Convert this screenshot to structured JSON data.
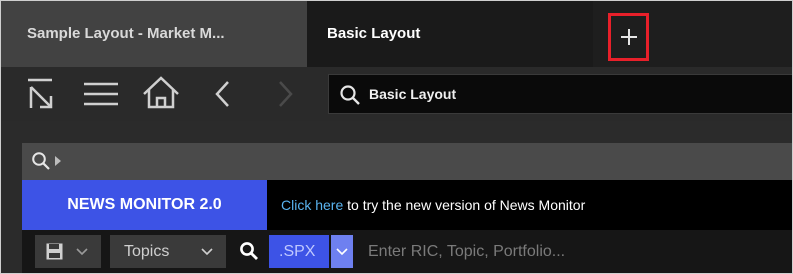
{
  "tabs": [
    {
      "label": "Sample Layout - Market M...",
      "active": false
    },
    {
      "label": "Basic Layout",
      "active": true
    }
  ],
  "toolbar": {
    "search_value": "Basic Layout"
  },
  "banner": {
    "badge": "NEWS MONITOR 2.0",
    "link": "Click here",
    "text": " to try the new version of News Monitor"
  },
  "bottombar": {
    "topics_label": "Topics",
    "ric_chip": ".SPX",
    "ric_placeholder": "Enter RIC, Topic, Portfolio..."
  },
  "colors": {
    "accent_blue": "#3d53e6",
    "link_blue": "#5ab4f0",
    "highlight_red": "#e8202a"
  }
}
